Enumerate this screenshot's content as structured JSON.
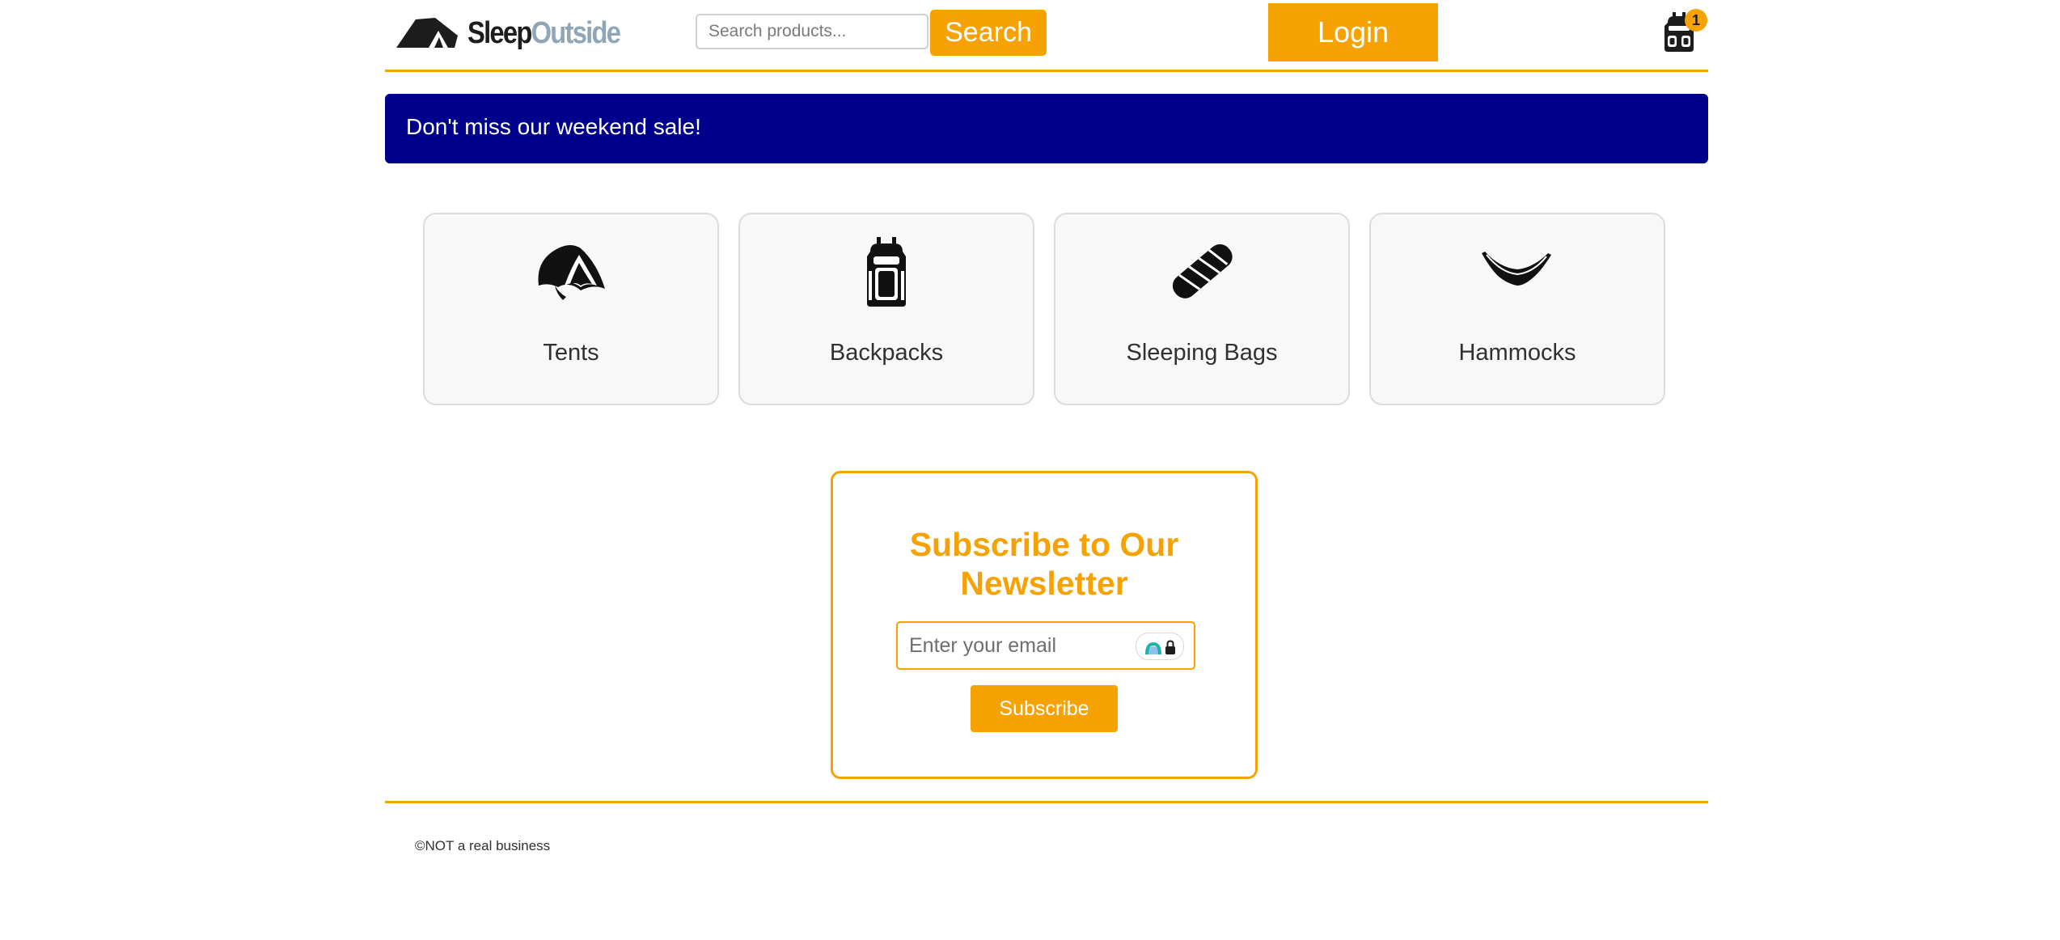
{
  "header": {
    "logo": {
      "part1": "Sleep",
      "part2": "Outside"
    },
    "search": {
      "placeholder": "Search products...",
      "value": "",
      "button_label": "Search"
    },
    "login_label": "Login",
    "cart": {
      "icon": "backpack-cart-icon",
      "count": "1"
    }
  },
  "alert": {
    "message": "Don't miss our weekend sale!"
  },
  "categories": [
    {
      "label": "Tents",
      "icon": "tent-icon"
    },
    {
      "label": "Backpacks",
      "icon": "backpack-icon"
    },
    {
      "label": "Sleeping Bags",
      "icon": "sleeping-bag-icon"
    },
    {
      "label": "Hammocks",
      "icon": "hammock-icon"
    }
  ],
  "newsletter": {
    "title": "Subscribe to Our Newsletter",
    "email_placeholder": "Enter your email",
    "email_value": "",
    "button_label": "Subscribe"
  },
  "footer": {
    "text": "©NOT a real business"
  },
  "colors": {
    "accent": "#f6a205",
    "alert_bg": "#00008b",
    "logo_dark": "#1d1d1d",
    "logo_light": "#8fa6b8"
  }
}
